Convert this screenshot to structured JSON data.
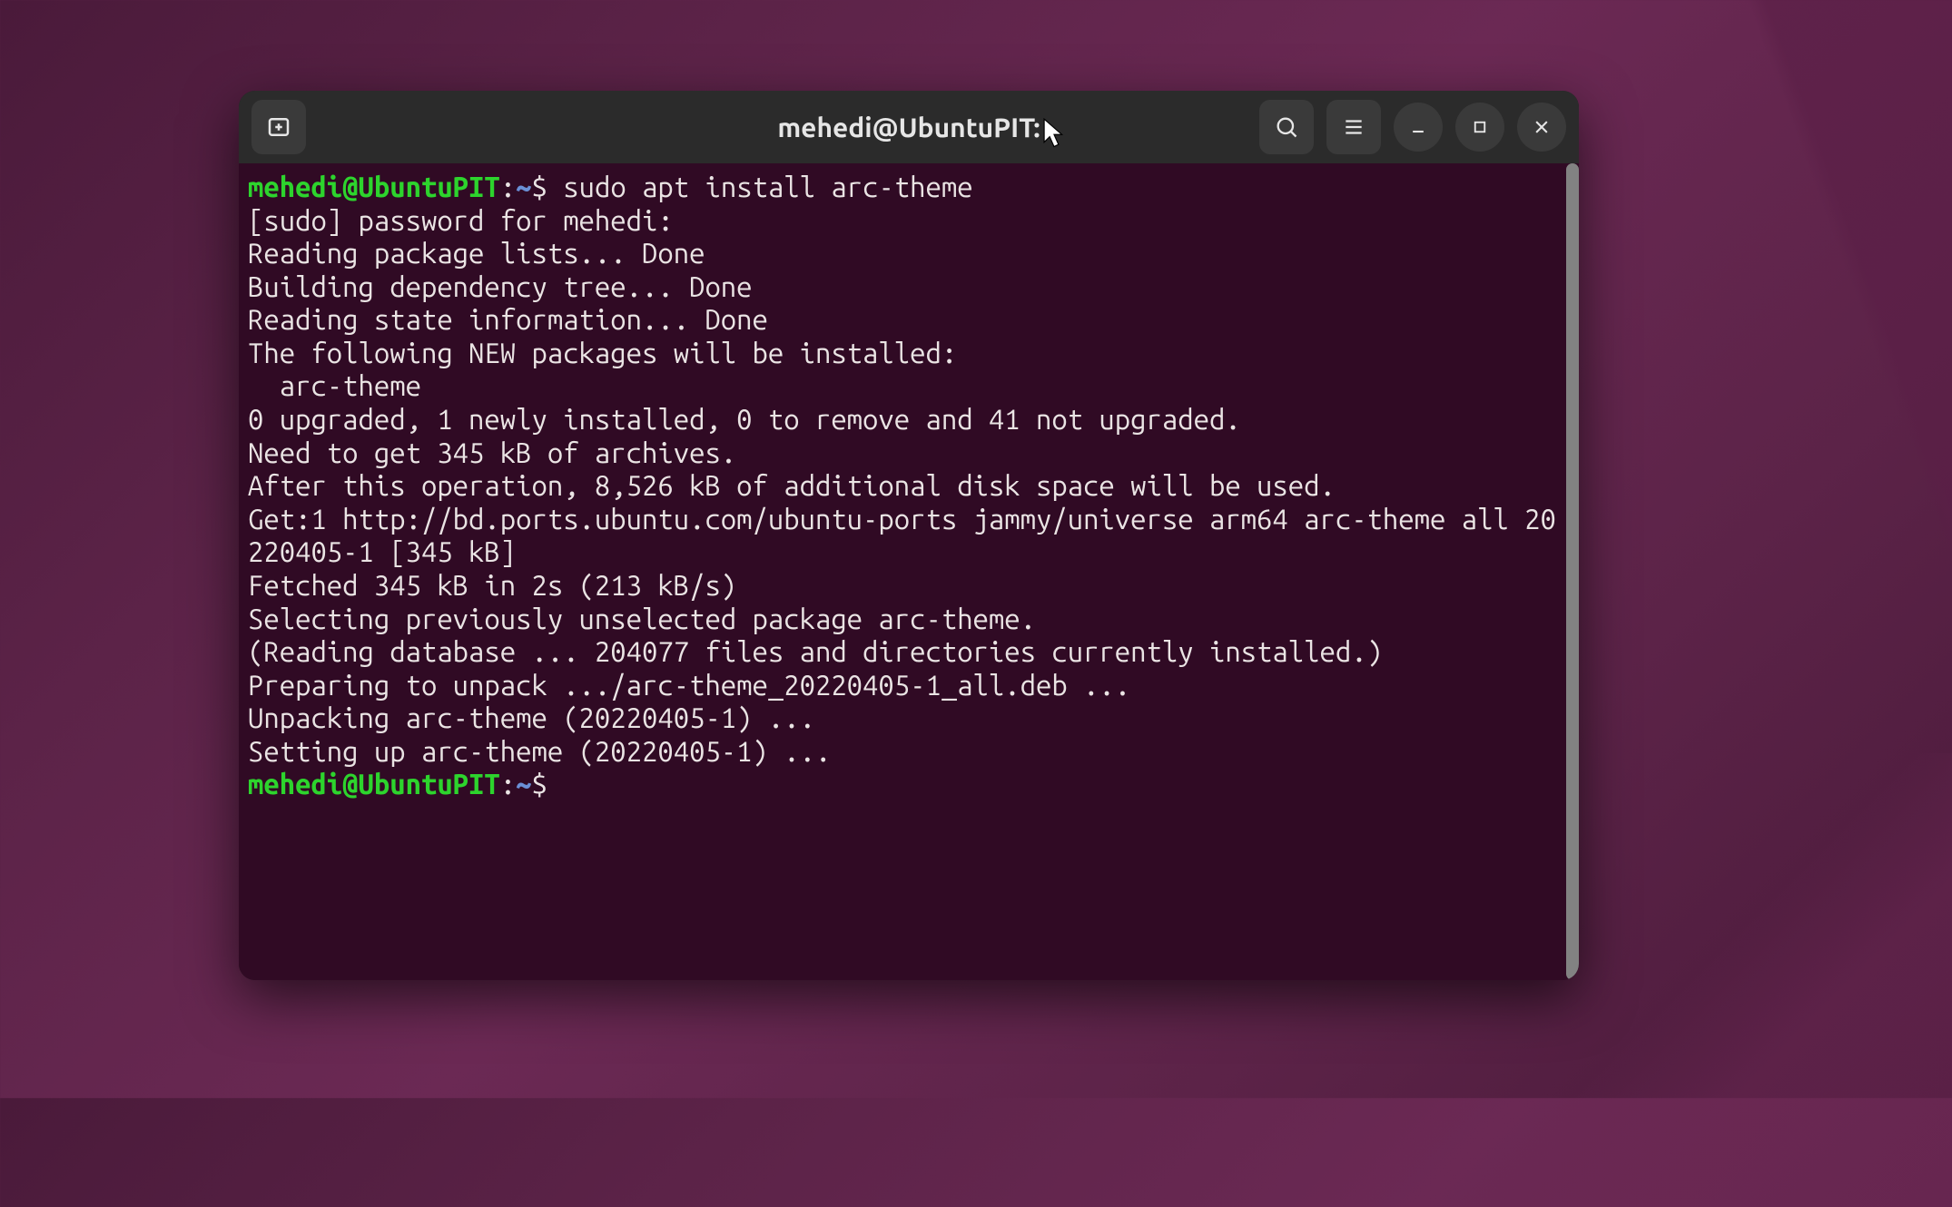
{
  "window": {
    "title": "mehedi@UbuntuPIT:"
  },
  "prompt": {
    "user_host": "mehedi@UbuntuPIT",
    "path": "~",
    "symbol": "$"
  },
  "command": "sudo apt install arc-theme",
  "output_lines": [
    "[sudo] password for mehedi: ",
    "Reading package lists... Done",
    "Building dependency tree... Done",
    "Reading state information... Done",
    "The following NEW packages will be installed:",
    "  arc-theme",
    "0 upgraded, 1 newly installed, 0 to remove and 41 not upgraded.",
    "Need to get 345 kB of archives.",
    "After this operation, 8,526 kB of additional disk space will be used.",
    "Get:1 http://bd.ports.ubuntu.com/ubuntu-ports jammy/universe arm64 arc-theme all 20220405-1 [345 kB]",
    "Fetched 345 kB in 2s (213 kB/s)",
    "Selecting previously unselected package arc-theme.",
    "(Reading database ... 204077 files and directories currently installed.)",
    "Preparing to unpack .../arc-theme_20220405-1_all.deb ...",
    "Unpacking arc-theme (20220405-1) ...",
    "Setting up arc-theme (20220405-1) ..."
  ]
}
